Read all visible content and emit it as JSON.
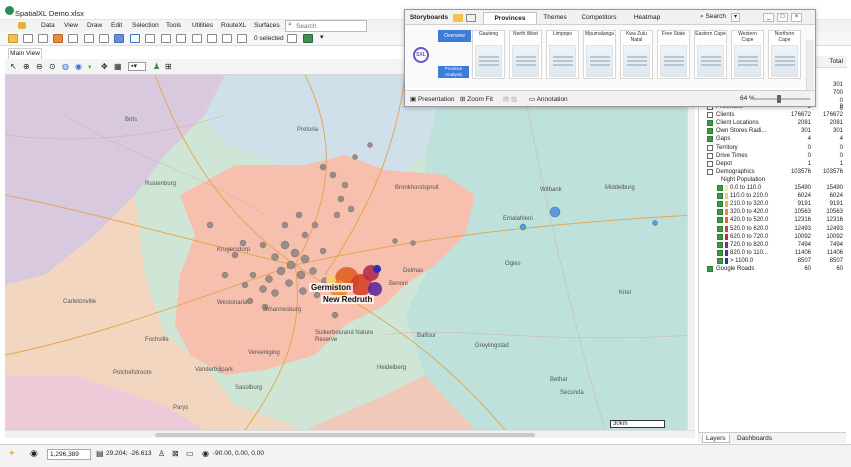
{
  "app": {
    "title": "SpatialXL Demo.xlsx"
  },
  "menu": {
    "items": [
      "Data",
      "View",
      "Draw",
      "Edit",
      "Selection",
      "Tools",
      "Utilities",
      "RouteXL",
      "Surfaces"
    ],
    "search_placeholder": "Search"
  },
  "toolbar": {
    "selected_count": "0 selected"
  },
  "view_tab": "Main View",
  "map": {
    "place_labels": [
      "Brits",
      "Rustenburg",
      "Pretoria",
      "Bronkhorstspruit",
      "Witbank",
      "Emalahleni",
      "Middelburg",
      "Krugersdorp",
      "Johannesburg",
      "Benoni",
      "Delmas",
      "Westonaria",
      "Carletonville",
      "Vereeniging",
      "Vanderbijlpark",
      "Potchefstroom",
      "Heidelberg",
      "Bethal",
      "Secunda",
      "Suikerbosrand Nature Reserve",
      "Fochville",
      "Kriel",
      "Ogies",
      "Balfour",
      "Greylingstad",
      "Parys",
      "Sasolburg"
    ],
    "highlight_labels": [
      "Germiston",
      "New Redruth"
    ],
    "scale_text": "30km"
  },
  "status": {
    "scale_value": "1,296,389",
    "coordinates": "29.204; -26.613",
    "camera": "-90.00, 0.00, 0.00"
  },
  "storyboards": {
    "tabs": [
      "Storyboards",
      "Provinces",
      "Themes",
      "Competitors",
      "Heatmap"
    ],
    "search_label": "Search",
    "window_buttons": [
      "_",
      "□",
      "×"
    ],
    "slides": [
      "Gauteng",
      "North West",
      "Limpopo",
      "Mpumalanga",
      "Kwa Zulu Natal",
      "Free State",
      "Eastern Cape",
      "Western Cape",
      "Northern Cape"
    ],
    "first_slide_top": "Overview",
    "first_slide_bottom": "Province Analysis",
    "logo_text": "SXL",
    "footer": {
      "presentation": "Presentation",
      "zoom_fit": "Zoom Fit",
      "annotation": "Annotation",
      "zoom_value": "64 %"
    }
  },
  "layers": {
    "header_total": "Total",
    "partial_values": [
      "301",
      "700",
      "0",
      "0",
      "9"
    ],
    "rows": [
      {
        "name": "Provinces",
        "v1": "9",
        "v2": "9",
        "checked": false,
        "indent": 1
      },
      {
        "name": "Clients",
        "v1": "176672",
        "v2": "176672",
        "checked": false,
        "indent": 1
      },
      {
        "name": "Client Locations",
        "v1": "2081",
        "v2": "2081",
        "checked": true,
        "indent": 1
      },
      {
        "name": "Own Stores Radi...",
        "v1": "301",
        "v2": "301",
        "checked": true,
        "indent": 1
      },
      {
        "name": "Gaps",
        "v1": "4",
        "v2": "4",
        "checked": true,
        "indent": 1
      },
      {
        "name": "Territory",
        "v1": "0",
        "v2": "0",
        "checked": false,
        "indent": 1
      },
      {
        "name": "Drive Times",
        "v1": "0",
        "v2": "0",
        "checked": false,
        "indent": 1
      },
      {
        "name": "Depot",
        "v1": "1",
        "v2": "1",
        "checked": false,
        "indent": 1
      },
      {
        "name": "Demographics",
        "v1": "103576",
        "v2": "103576",
        "checked": false,
        "indent": 1
      },
      {
        "name": "Night Population",
        "v1": "",
        "v2": "",
        "checked": false,
        "indent": 2,
        "nocheck": true
      },
      {
        "name": "0.0 to 110.0",
        "v1": "15490",
        "v2": "15490",
        "checked": true,
        "indent": 3,
        "swatch": "#f7e6a0"
      },
      {
        "name": "110.0 to 210.0",
        "v1": "6024",
        "v2": "6024",
        "checked": true,
        "indent": 3,
        "swatch": "#f3cf6c"
      },
      {
        "name": "210.0 to 320.0",
        "v1": "9191",
        "v2": "9191",
        "checked": true,
        "indent": 3,
        "swatch": "#efb048"
      },
      {
        "name": "320.0 to 420.0",
        "v1": "10563",
        "v2": "10563",
        "checked": true,
        "indent": 3,
        "swatch": "#ea8a35"
      },
      {
        "name": "420.0 to 520.0",
        "v1": "12316",
        "v2": "12316",
        "checked": true,
        "indent": 3,
        "swatch": "#e2652a"
      },
      {
        "name": "520.0 to 620.0",
        "v1": "12493",
        "v2": "12493",
        "checked": true,
        "indent": 3,
        "swatch": "#d6402a"
      },
      {
        "name": "620.0 to 720.0",
        "v1": "10092",
        "v2": "10092",
        "checked": true,
        "indent": 3,
        "swatch": "#b52c4a"
      },
      {
        "name": "720.0 to 820.0",
        "v1": "7494",
        "v2": "7494",
        "checked": true,
        "indent": 3,
        "swatch": "#8a2a78"
      },
      {
        "name": "820.0 to 110...",
        "v1": "11406",
        "v2": "11406",
        "checked": true,
        "indent": 3,
        "swatch": "#5a2b9a"
      },
      {
        "name": "> 1100.0",
        "v1": "8507",
        "v2": "8507",
        "checked": true,
        "indent": 3,
        "swatch": "#2b2fa8"
      },
      {
        "name": "Google Roads",
        "v1": "60",
        "v2": "60",
        "checked": true,
        "indent": 1
      }
    ]
  },
  "panel_tabs": [
    "Layers",
    "Dashboards"
  ]
}
